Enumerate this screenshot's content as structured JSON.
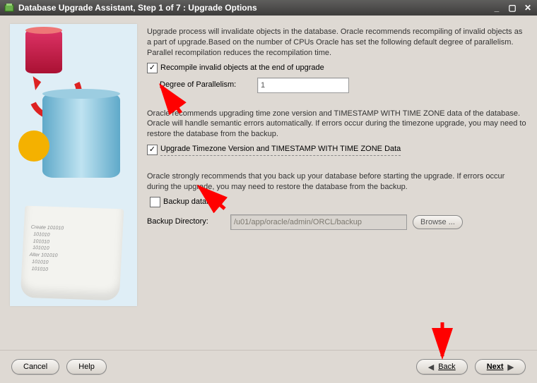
{
  "titlebar": {
    "title": "Database Upgrade Assistant, Step 1 of 7 : Upgrade Options"
  },
  "section1": {
    "text": "Upgrade process will invalidate objects in the database. Oracle recommends recompiling of invalid objects as a part of upgrade.Based on the number of CPUs Oracle has set the following default degree of parallelism. Parallel recompilation reduces the recompilation time.",
    "checkbox_label": "Recompile invalid objects at the end of upgrade",
    "checkbox_checked": true,
    "parallel_label": "Degree of Parallelism:",
    "parallel_value": "1"
  },
  "section2": {
    "text": "Oracle recommends upgrading time zone version and TIMESTAMP WITH TIME ZONE data of the database. Oracle will handle semantic errors automatically. If errors occur during the timezone upgrade, you may need to restore the database from the backup.",
    "checkbox_label": "Upgrade Timezone Version and TIMESTAMP WITH TIME ZONE Data",
    "checkbox_checked": true
  },
  "section3": {
    "text": "Oracle strongly recommends that you back up your database before starting the upgrade. If errors occur during the upgrade, you may need to restore the database from the backup.",
    "checkbox_label": "Backup database",
    "checkbox_checked": false,
    "dir_label": "Backup Directory:",
    "dir_value": "/u01/app/oracle/admin/ORCL/backup",
    "browse_label": "Browse ..."
  },
  "illus": {
    "scroll_text": "Create 101010\n  101010\n  101010\n  101010\nAlter 101010\n  101010\n  101010"
  },
  "footer": {
    "cancel": "Cancel",
    "help": "Help",
    "back": "Back",
    "next": "Next"
  }
}
